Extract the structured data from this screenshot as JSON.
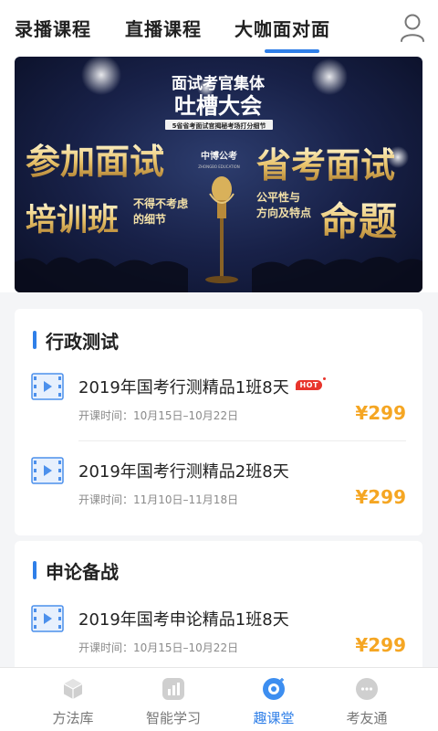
{
  "top_tabs": [
    {
      "label": "录播课程"
    },
    {
      "label": "直播课程"
    },
    {
      "label": "大咖面对面",
      "active": true
    }
  ],
  "banner": {
    "headline_top": "面试考官集体",
    "headline_main": "吐槽大会",
    "ribbon": "5省省考面试官揭秘考场打分细节",
    "brand_cn": "中博公考",
    "brand_en": "ZHONGBO EDUCATION",
    "left_big_1": "参加面试",
    "left_big_2": "培训班",
    "left_small_1": "不得不考虑",
    "left_small_2": "的细节",
    "right_big_1": "省考面试",
    "right_big_2": "命题",
    "right_small_1": "公平性与",
    "right_small_2": "方向及特点"
  },
  "sections": [
    {
      "title": "行政测试",
      "courses": [
        {
          "name": "2019年国考行测精品1班8天",
          "badge": "HOT",
          "time": "开课时间：10月15日–10月22日",
          "price": "¥299"
        },
        {
          "name": "2019年国考行测精品2班8天",
          "time": "开课时间：11月10日–11月18日",
          "price": "¥299"
        }
      ]
    },
    {
      "title": "申论备战",
      "courses": [
        {
          "name": "2019年国考申论精品1班8天",
          "time": "开课时间：10月15日–10月22日",
          "price": "¥299"
        }
      ]
    }
  ],
  "bottom_nav": [
    {
      "label": "方法库",
      "icon": "cube-icon"
    },
    {
      "label": "智能学习",
      "icon": "chart-icon"
    },
    {
      "label": "趣课堂",
      "icon": "play-circle-icon",
      "active": true
    },
    {
      "label": "考友通",
      "icon": "chat-bubble-icon"
    }
  ],
  "colors": {
    "accent": "#2f7fe8",
    "price": "#f5a623",
    "hot": "#e8352c"
  }
}
